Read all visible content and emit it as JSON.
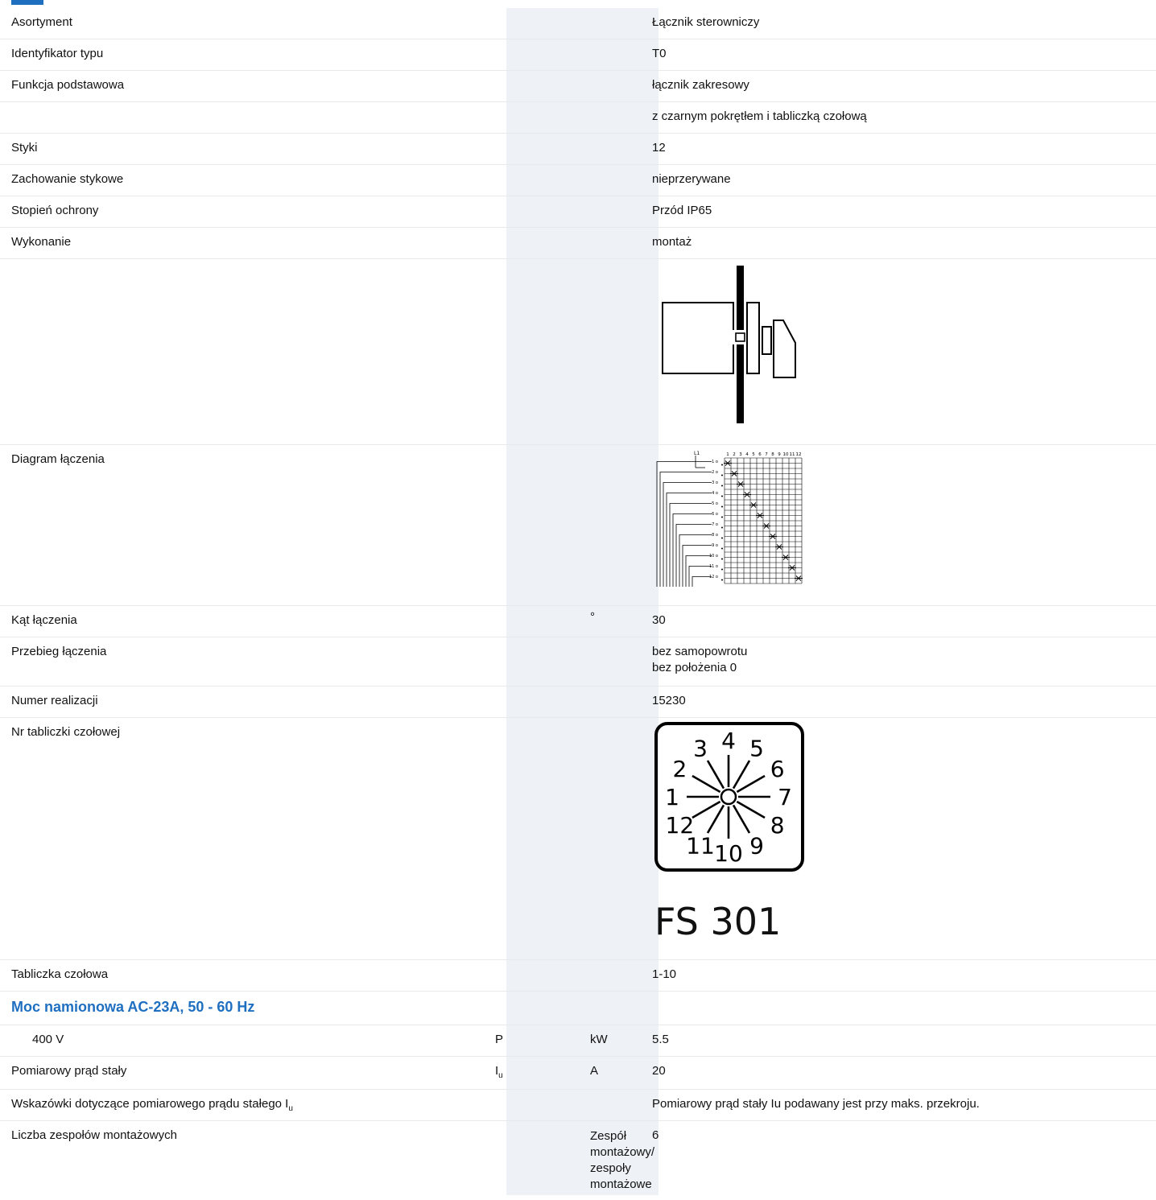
{
  "rows": [
    {
      "label": "Asortyment",
      "value": "Łącznik sterowniczy"
    },
    {
      "label": "Identyfikator typu",
      "value": "T0"
    },
    {
      "label": "Funkcja podstawowa",
      "value": "łącznik zakresowy"
    },
    {
      "label": "",
      "value": "z czarnym pokrętłem i tabliczką czołową"
    },
    {
      "label": "Styki",
      "value": "12"
    },
    {
      "label": "Zachowanie stykowe",
      "value": "nieprzerywane"
    },
    {
      "label": "Stopień ochrony",
      "value": "Przód IP65"
    },
    {
      "label": "Wykonanie",
      "value": "montaż"
    }
  ],
  "diagram_row": {
    "label": "Diagram łączenia"
  },
  "diagram": {
    "top_label": "L1",
    "col_numbers": [
      "1",
      "2",
      "3",
      "4",
      "5",
      "6",
      "7",
      "8",
      "9",
      "10",
      "11",
      "12"
    ],
    "row_numbers": [
      "1",
      "2",
      "3",
      "4",
      "5",
      "6",
      "7",
      "8",
      "9",
      "10",
      "11",
      "12"
    ]
  },
  "angle_row": {
    "label": "Kąt łączenia",
    "unit": "°",
    "value": "30"
  },
  "sequence_row": {
    "label": "Przebieg łączenia",
    "value_line1": "bez samopowrotu",
    "value_line2": "bez położenia 0"
  },
  "number_row": {
    "label": "Numer realizacji",
    "value": "15230"
  },
  "plate_row": {
    "label": "Nr tabliczki czołowej",
    "dial_numbers": [
      "1",
      "2",
      "3",
      "4",
      "5",
      "6",
      "7",
      "8",
      "9",
      "10",
      "11",
      "12"
    ],
    "plate_code": "FS 301"
  },
  "plate2_row": {
    "label": "Tabliczka czołowa",
    "value": "1-10"
  },
  "section": {
    "title": "Moc namionowa AC-23A, 50 - 60 Hz"
  },
  "power_row": {
    "label": "400 V",
    "symbol": "P",
    "unit": "kW",
    "value": "5.5"
  },
  "current_row": {
    "label": "Pomiarowy prąd stały",
    "symbol_main": "I",
    "symbol_sub": "u",
    "unit": "A",
    "value": "20"
  },
  "note_row": {
    "label_main": "Wskazówki dotyczące pomiarowego prądu stałego I",
    "label_sub": "u",
    "value": "Pomiarowy prąd stały Iu podawany jest przy maks. przekroju."
  },
  "units_row": {
    "label": "Liczba zespołów montażowych",
    "unit": "Zespół montażowy/ zespoły montażowe",
    "value": "6"
  }
}
